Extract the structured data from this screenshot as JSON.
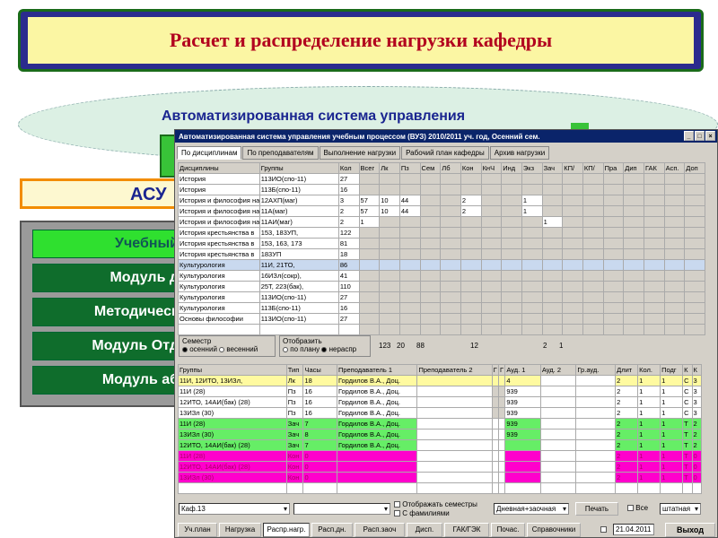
{
  "banner": {
    "title": "Расчет и распределение нагрузки кафедры"
  },
  "cloud": {
    "title": "Автоматизированная система управления"
  },
  "asu": {
    "label": "АСУ"
  },
  "modules": [
    {
      "label": "Учебный"
    },
    {
      "label": "Модуль д"
    },
    {
      "label": "Методическ"
    },
    {
      "label": "Модуль Отд"
    },
    {
      "label": "Модуль аб"
    }
  ],
  "window": {
    "title": "Автоматизированная система управления учебным процессом         (ВУЗ)    2010/2011 уч. год, Осенний сем.",
    "tabs": [
      "По дисциплинам",
      "По преподавателям",
      "Выполнение нагрузки",
      "Рабочий план кафедры",
      "Архив нагрузки"
    ]
  },
  "top_table": {
    "headers": [
      "Дисциплины",
      "Группы",
      "Кол",
      "Всег",
      "Лк",
      "Пз",
      "Сем",
      "Лб",
      "Кон",
      "КнЧ",
      "Инд",
      "Экз",
      "Зач",
      "КП/",
      "КП/",
      "Пра",
      "Дип",
      "ГАК",
      "Асп.",
      "Доп"
    ],
    "rows": [
      [
        "История",
        "113ИО(спо-11)",
        "27",
        "",
        "",
        "",
        "",
        "",
        "",
        "",
        "",
        "",
        "",
        "",
        "",
        "",
        "",
        "",
        "",
        ""
      ],
      [
        "История",
        "113Б(спо-11)",
        "16",
        "",
        "",
        "",
        "",
        "",
        "",
        "",
        "",
        "",
        "",
        "",
        "",
        "",
        "",
        "",
        "",
        ""
      ],
      [
        "История и философия науки",
        "12АХП(маг)",
        "3",
        "57",
        "10",
        "44",
        "",
        "",
        "2",
        "",
        "",
        "1",
        "",
        "",
        "",
        "",
        "",
        "",
        "",
        ""
      ],
      [
        "История и философия науки",
        "11А(маг)",
        "2",
        "57",
        "10",
        "44",
        "",
        "",
        "2",
        "",
        "",
        "1",
        "",
        "",
        "",
        "",
        "",
        "",
        "",
        ""
      ],
      [
        "История и философия науки",
        "11АИ(маг)",
        "2",
        "1",
        "",
        "",
        "",
        "",
        "",
        "",
        "",
        "",
        "1",
        "",
        "",
        "",
        "",
        "",
        "",
        ""
      ],
      [
        "История крестьянства в",
        "153, 183УП,",
        "122",
        "",
        "",
        "",
        "",
        "",
        "",
        "",
        "",
        "",
        "",
        "",
        "",
        "",
        "",
        "",
        "",
        ""
      ],
      [
        "История крестьянства в",
        "153, 163, 173",
        "81",
        "",
        "",
        "",
        "",
        "",
        "",
        "",
        "",
        "",
        "",
        "",
        "",
        "",
        "",
        "",
        "",
        ""
      ],
      [
        "История крестьянства в",
        "183УП",
        "18",
        "",
        "",
        "",
        "",
        "",
        "",
        "",
        "",
        "",
        "",
        "",
        "",
        "",
        "",
        "",
        "",
        ""
      ],
      [
        "Культурология",
        "11И, 21ТО,",
        "86",
        "",
        "",
        "",
        "",
        "",
        "",
        "",
        "",
        "",
        "",
        "",
        "",
        "",
        "",
        "",
        "",
        ""
      ],
      [
        "Культурология",
        "16ИЗл(сокр),",
        "41",
        "",
        "",
        "",
        "",
        "",
        "",
        "",
        "",
        "",
        "",
        "",
        "",
        "",
        "",
        "",
        "",
        ""
      ],
      [
        "Культурология",
        "25Т, 223(бак),",
        "110",
        "",
        "",
        "",
        "",
        "",
        "",
        "",
        "",
        "",
        "",
        "",
        "",
        "",
        "",
        "",
        "",
        ""
      ],
      [
        "Культурология",
        "113ИО(спо-11)",
        "27",
        "",
        "",
        "",
        "",
        "",
        "",
        "",
        "",
        "",
        "",
        "",
        "",
        "",
        "",
        "",
        "",
        ""
      ],
      [
        "Культурология",
        "113Б(спо-11)",
        "16",
        "",
        "",
        "",
        "",
        "",
        "",
        "",
        "",
        "",
        "",
        "",
        "",
        "",
        "",
        "",
        "",
        ""
      ],
      [
        "Основы философии",
        "113ИО(спо-11)",
        "27",
        "",
        "",
        "",
        "",
        "",
        "",
        "",
        "",
        "",
        "",
        "",
        "",
        "",
        "",
        "",
        "",
        ""
      ]
    ],
    "totals": [
      "123",
      "20",
      "88",
      "",
      "",
      "12",
      "",
      "",
      "",
      "2",
      "1"
    ]
  },
  "semester": {
    "label": "Семестр",
    "opt1": "осенний",
    "opt2": "весенний"
  },
  "show": {
    "label": "Отобразить",
    "opt1": "по плану",
    "opt2": "нераспр"
  },
  "bottom_table": {
    "headers": [
      "Группы",
      "Тип",
      "Часы",
      "Преподаватель 1",
      "Преподаватель 2",
      "Г",
      "Г",
      "Ауд. 1",
      "Ауд. 2",
      "Гр.ауд.",
      "Длит",
      "Кол.",
      "Подг",
      "К",
      "К"
    ],
    "rows": [
      {
        "c": "ylw",
        "v": [
          "11И, 12ИТО, 13ИЗл,",
          "Лк",
          "18",
          "Гордилов В.А., Доц.",
          "",
          "",
          "",
          "4",
          "",
          "",
          "2",
          "1",
          "1",
          "С",
          "3"
        ]
      },
      {
        "c": "",
        "v": [
          "11И (28)",
          "Пз",
          "16",
          "Гордилов В.А., Доц.",
          "",
          "",
          "",
          "939",
          "",
          "",
          "2",
          "1",
          "1",
          "С",
          "3"
        ]
      },
      {
        "c": "",
        "v": [
          "12ИТО, 14АИ(бак) (28)",
          "Пз",
          "16",
          "Гордилов В.А., Доц.",
          "",
          "",
          "",
          "939",
          "",
          "",
          "2",
          "1",
          "1",
          "С",
          "3"
        ]
      },
      {
        "c": "",
        "v": [
          "13ИЗл (30)",
          "Пз",
          "16",
          "Гордилов В.А., Доц.",
          "",
          "",
          "",
          "939",
          "",
          "",
          "2",
          "1",
          "1",
          "С",
          "3"
        ]
      },
      {
        "c": "grn",
        "v": [
          "11И (28)",
          "Зач",
          "7",
          "Гордилов В.А., Доц.",
          "",
          "",
          "",
          "939",
          "",
          "",
          "2",
          "1",
          "1",
          "Т",
          "2"
        ]
      },
      {
        "c": "grn",
        "v": [
          "13ИЗл (30)",
          "Зач",
          "8",
          "Гордилов В.А., Доц.",
          "",
          "",
          "",
          "939",
          "",
          "",
          "2",
          "1",
          "1",
          "Т",
          "2"
        ]
      },
      {
        "c": "grn",
        "v": [
          "12ИТО, 14АИ(бак) (28)",
          "Зач",
          "7",
          "Гордилов В.А., Доц.",
          "",
          "",
          "",
          "",
          "",
          "",
          "2",
          "1",
          "1",
          "Т",
          "2"
        ]
      },
      {
        "c": "mag",
        "v": [
          "11И (28)",
          "Кон",
          "0",
          "",
          "",
          "",
          "",
          "",
          "",
          "",
          "2",
          "1",
          "1",
          "Т",
          "0"
        ]
      },
      {
        "c": "mag",
        "v": [
          "12ИТО, 14АИ(бак) (28)",
          "Кон",
          "0",
          "",
          "",
          "",
          "",
          "",
          "",
          "",
          "2",
          "1",
          "1",
          "Т",
          "0"
        ]
      },
      {
        "c": "mag",
        "v": [
          "13ИЗл (30)",
          "Кон",
          "0",
          "",
          "",
          "",
          "",
          "",
          "",
          "",
          "2",
          "1",
          "1",
          "Т",
          "0"
        ]
      }
    ]
  },
  "controls": {
    "dept": "Каф.13",
    "show_semesters": "Отображать семестры",
    "with_names": "С фамилиями",
    "form": "Дневная+заочная",
    "print": "Печать",
    "all": "Все",
    "staff": "штатная"
  },
  "bottom_buttons": [
    "Уч.план",
    "Нагрузка",
    "Распр.нагр.",
    "Расп.дн.",
    "Расп.заоч",
    "Дисп.",
    "ГАК/ГЭК",
    "Почас.",
    "Справочники"
  ],
  "date": "21.04.2011",
  "exit": "Выход"
}
